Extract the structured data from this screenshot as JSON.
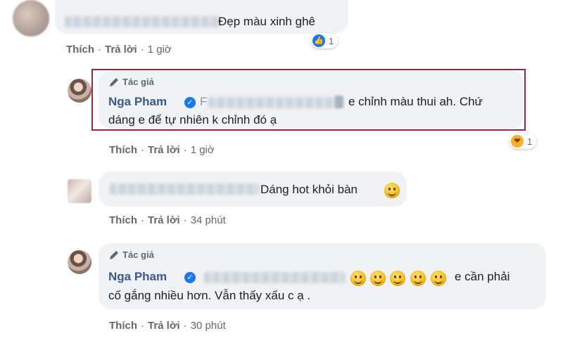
{
  "comments": [
    {
      "text": "Đẹp màu xinh ghê",
      "actions": {
        "like": "Thích",
        "reply": "Trả lời",
        "time": "1 giờ"
      },
      "reaction": {
        "icon": "like-icon",
        "count": "1"
      }
    },
    {
      "author_badge": "Tác giả",
      "name": "Nga Pham",
      "tag_initial": "F",
      "text_line1": "e chỉnh màu thui ah. Chứ",
      "text_line2": "dáng e để tự nhiên k chỉnh đó ạ",
      "actions": {
        "like": "Thích",
        "reply": "Trả lời",
        "time": "1 giờ"
      },
      "reaction": {
        "icon": "care-icon",
        "count": "1"
      }
    },
    {
      "text": "Dáng hot khỏi bàn",
      "actions": {
        "like": "Thích",
        "reply": "Trả lời",
        "time": "34 phút"
      }
    },
    {
      "author_badge": "Tác giả",
      "name": "Nga Pham",
      "text_line1": "e cần phải",
      "text_line2": "cố gắng nhiều hơn. Vẫn thấy xấu c ạ .",
      "actions": {
        "like": "Thích",
        "reply": "Trả lời",
        "time": "30 phút"
      }
    }
  ],
  "separator": "·",
  "colors": {
    "name": "#385898",
    "bubble": "#f0f2f5",
    "highlight": "#a3243f",
    "link": "#65676b"
  }
}
